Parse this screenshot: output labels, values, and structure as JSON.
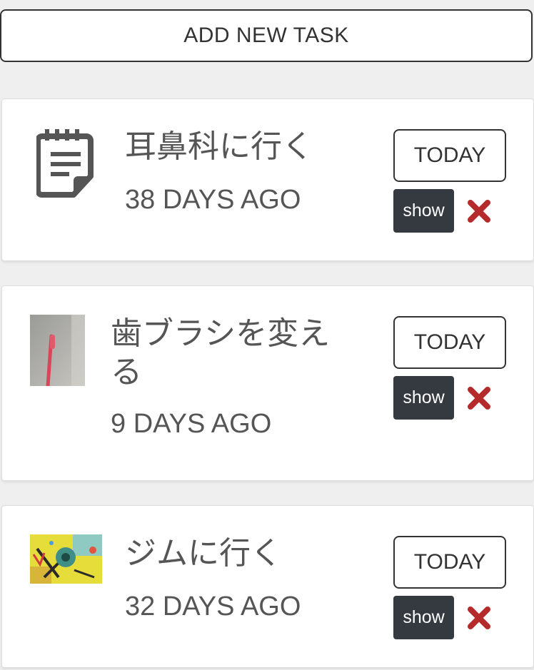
{
  "add_button": {
    "label": "ADD NEW TASK"
  },
  "tasks": [
    {
      "title": "耳鼻科に行く",
      "ago": "38 DAYS AGO",
      "today_label": "TODAY",
      "show_label": "show",
      "thumb": "notepad-icon"
    },
    {
      "title_line1": "歯ブラシを変え",
      "title_line2": "る",
      "ago": "9 DAYS AGO",
      "today_label": "TODAY",
      "show_label": "show",
      "thumb": "toothbrush-photo"
    },
    {
      "title": "ジムに行く",
      "ago": "32 DAYS AGO",
      "today_label": "TODAY",
      "show_label": "show",
      "thumb": "gym-photo"
    }
  ],
  "colors": {
    "delete": "#b52a2a",
    "show_bg": "#343a40",
    "page_bg": "#efefef"
  }
}
